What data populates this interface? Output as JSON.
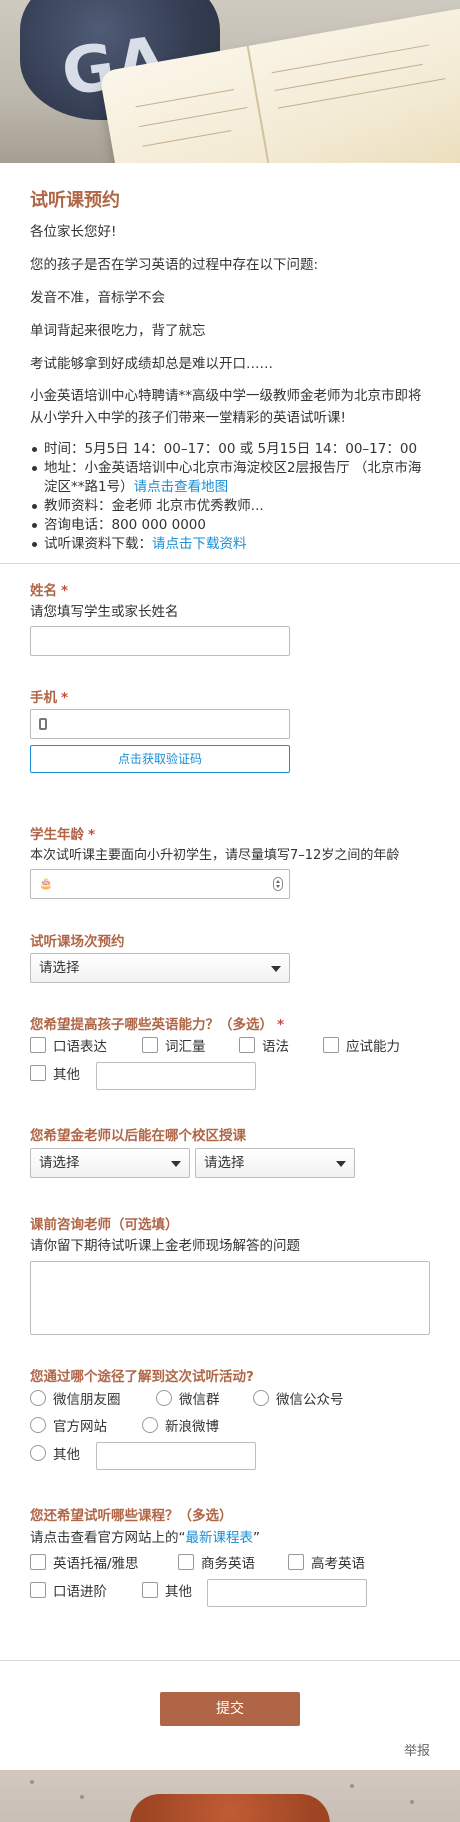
{
  "intro": {
    "title": "试听课预约",
    "greeting": "各位家长您好!",
    "question": "您的孩子是否在学习英语的过程中存在以下问题:",
    "problem1": "发音不准，音标学不会",
    "problem2": "单词背起来很吃力，背了就忘",
    "problem3": "考试能够拿到好成绩却总是难以开口……",
    "invite": "小金英语培训中心特聘请**高级中学一级教师金老师为北京市即将从小学升入中学的孩子们带来一堂精彩的英语试听课!",
    "bullets": {
      "time": "时间：5月5日 14：00–17：00 或 5月15日 14：00–17：00",
      "address": "地址：小金英语培训中心北京市海淀校区2层报告厅 （北京市海淀区**路1号）",
      "address_link": "请点击查看地图",
      "teacher": "教师资料：金老师 北京市优秀教师...",
      "phone": "咨询电话：800 000 0000",
      "download": "试听课资料下载：",
      "download_link": "请点击下载资料"
    }
  },
  "form": {
    "name": {
      "label": "姓名",
      "required": "*",
      "desc": "请您填写学生或家长姓名",
      "value": ""
    },
    "phone": {
      "label": "手机",
      "required": "*",
      "value": "",
      "verify_button": "点击获取验证码"
    },
    "age": {
      "label": "学生年龄",
      "required": "*",
      "desc": "本次试听课主要面向小升初学生，请尽量填写7–12岁之间的年龄",
      "icon_text": "🎂",
      "value": ""
    },
    "session": {
      "label": "试听课场次预约",
      "selected": "请选择"
    },
    "ability": {
      "label": "您希望提高孩子哪些英语能力？（多选）",
      "required": "*",
      "options": [
        "口语表达",
        "词汇量",
        "语法",
        "应试能力",
        "其他"
      ]
    },
    "campus": {
      "label": "您希望金老师以后能在哪个校区授课",
      "select1": "请选择",
      "select2": "请选择"
    },
    "consult": {
      "label": "课前咨询老师（可选填）",
      "desc": "请你留下期待试听课上金老师现场解答的问题",
      "value": ""
    },
    "source": {
      "label": "您通过哪个途径了解到这次试听活动?",
      "options": [
        "微信朋友圈",
        "微信群",
        "微信公众号",
        "官方网站",
        "新浪微博",
        "其他"
      ]
    },
    "courses": {
      "label": "您还希望试听哪些课程？（多选）",
      "desc_prefix": "请点击查看官方网站上的“",
      "desc_link": "最新课程表",
      "desc_suffix": "”",
      "options": [
        "英语托福/雅思",
        "商务英语",
        "高考英语",
        "口语进阶",
        "其他"
      ]
    },
    "submit": "提交",
    "report": "举报"
  },
  "colors": {
    "accent": "#b06646",
    "link": "#1a8fd6",
    "required": "#c94b36"
  }
}
